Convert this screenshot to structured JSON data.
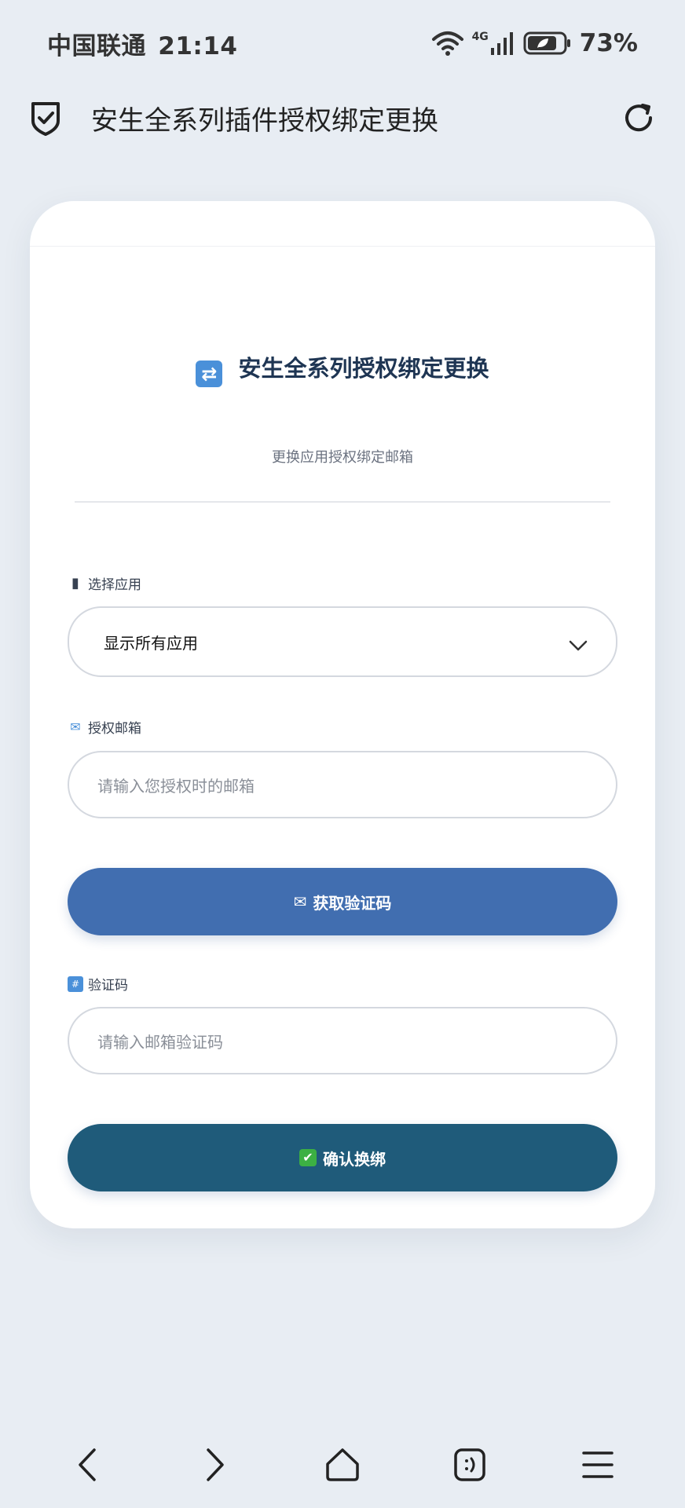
{
  "status_bar": {
    "carrier": "中国联通",
    "time": "21:14",
    "network": "4G",
    "battery": "73%"
  },
  "header": {
    "title": "安生全系列插件授权绑定更换",
    "icons": {
      "left": "shield-check-icon",
      "right": "reload-icon"
    }
  },
  "card": {
    "title": "安生全系列授权绑定更换",
    "subtitle": "更换应用授权绑定邮箱",
    "select_app": {
      "label": "选择应用",
      "selected": "显示所有应用"
    },
    "email": {
      "label": "授权邮箱",
      "placeholder": "请输入您授权时的邮箱"
    },
    "get_code_button": "获取验证码",
    "code": {
      "label": "验证码",
      "placeholder": "请输入邮箱验证码"
    },
    "confirm_button": "确认换绑"
  },
  "colors": {
    "background": "#e8edf3",
    "primary_button": "#416eb0",
    "confirm_button": "#1f5b7a",
    "title": "#1e3553"
  },
  "bottom_nav": {
    "icons": [
      "back-icon",
      "forward-icon",
      "home-icon",
      "tabs-icon",
      "menu-icon"
    ]
  }
}
